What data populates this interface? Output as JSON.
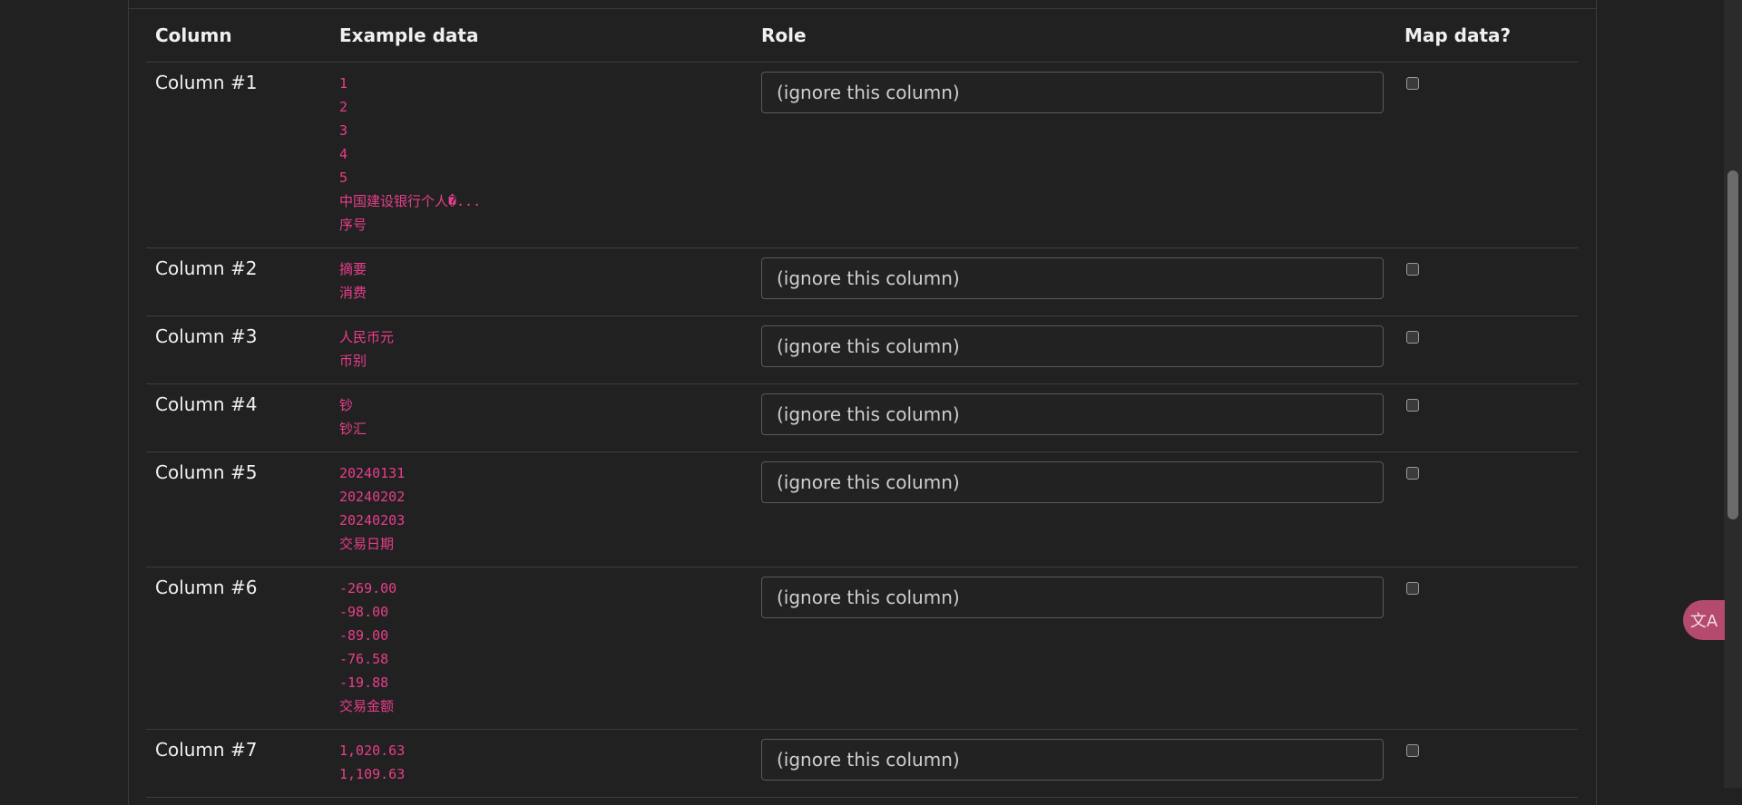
{
  "table": {
    "headers": {
      "column": "Column",
      "example": "Example data",
      "role": "Role",
      "map": "Map data?"
    },
    "rows": [
      {
        "name": "Column #1",
        "examples": [
          "1",
          "2",
          "3",
          "4",
          "5",
          "中国建设银行个人�...",
          "序号"
        ],
        "role": "(ignore this column)",
        "map_checked": false
      },
      {
        "name": "Column #2",
        "examples": [
          "摘要",
          "消费"
        ],
        "role": "(ignore this column)",
        "map_checked": false
      },
      {
        "name": "Column #3",
        "examples": [
          "人民币元",
          "币别"
        ],
        "role": "(ignore this column)",
        "map_checked": false
      },
      {
        "name": "Column #4",
        "examples": [
          "钞",
          "钞汇"
        ],
        "role": "(ignore this column)",
        "map_checked": false
      },
      {
        "name": "Column #5",
        "examples": [
          "20240131",
          "20240202",
          "20240203",
          "交易日期"
        ],
        "role": "(ignore this column)",
        "map_checked": false
      },
      {
        "name": "Column #6",
        "examples": [
          "-269.00",
          "-98.00",
          "-89.00",
          "-76.58",
          "-19.88",
          "交易金额"
        ],
        "role": "(ignore this column)",
        "map_checked": false
      },
      {
        "name": "Column #7",
        "examples": [
          "1,020.63",
          "1,109.63"
        ],
        "role": "(ignore this column)",
        "map_checked": false
      }
    ]
  },
  "translate_button": {
    "icon": "translate-icon",
    "glyph": "文A"
  },
  "colors": {
    "background": "#212121",
    "example_text": "#e83e8c",
    "translate_fab": "#b44a6e"
  }
}
